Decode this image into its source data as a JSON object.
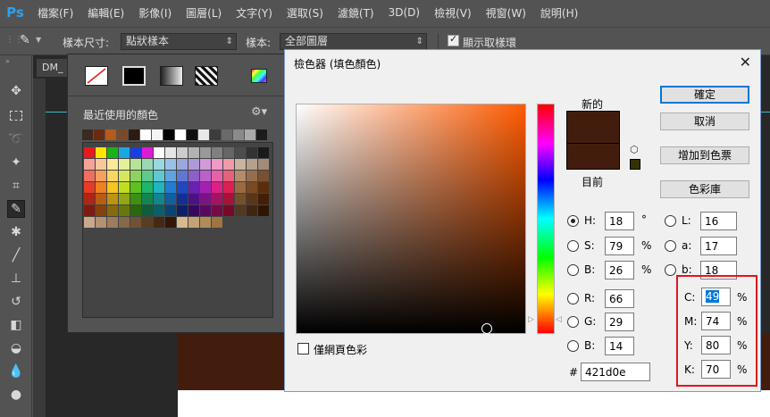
{
  "app": {
    "logo": "Ps"
  },
  "menu": [
    "檔案(F)",
    "編輯(E)",
    "影像(I)",
    "圖層(L)",
    "文字(Y)",
    "選取(S)",
    "濾鏡(T)",
    "3D(D)",
    "檢視(V)",
    "視窗(W)",
    "說明(H)"
  ],
  "options": {
    "sample_size_label": "樣本尺寸:",
    "sample_size_value": "點狀樣本",
    "sample_label": "樣本:",
    "sample_value": "全部圖層",
    "show_ring_label": "顯示取樣環"
  },
  "doc_tab": "DM_",
  "swatches": {
    "title": "最近使用的顏色",
    "recent": [
      "#3a2a20",
      "#6b2a10",
      "#b85a18",
      "#7a4a28",
      "#2e1a10",
      "#ffffff",
      "#f4f4f4",
      "#000000",
      "#ffffff",
      "#101010",
      "#e8e8e8",
      "#3c3c3c",
      "#6a6a6a",
      "#8a8a8a",
      "#aaaaaa",
      "#1c1c1c"
    ],
    "rows": [
      [
        "#e51b1b",
        "#ffe600",
        "#19b319",
        "#19a8e0",
        "#1a3fe0",
        "#e019d6",
        "#ffffff",
        "#e6e6e6",
        "#cccccc",
        "#b3b3b3",
        "#999999",
        "#808080",
        "#666666",
        "#4d4d4d",
        "#333333",
        "#1a1a1a"
      ],
      [
        "#f4a39a",
        "#f7c99a",
        "#fbe89a",
        "#e4f09a",
        "#b7e29a",
        "#9ad8b5",
        "#9ad8e0",
        "#9ac2e8",
        "#9aa8e0",
        "#ae9ad8",
        "#d19ad8",
        "#f09ac8",
        "#f09aa8",
        "#c8b4a0",
        "#b4a08c",
        "#a08c78"
      ],
      [
        "#ee6f5f",
        "#f4a160",
        "#f9d760",
        "#d5e760",
        "#8fd260",
        "#60c890",
        "#60c8d3",
        "#60a3de",
        "#6078d3",
        "#8c60c8",
        "#bd60c8",
        "#e860a8",
        "#e8607c",
        "#b48c6c",
        "#966e4e",
        "#785032"
      ],
      [
        "#e83b27",
        "#f07f1f",
        "#f6c51f",
        "#c1dd1f",
        "#5ec11f",
        "#1fb56b",
        "#1fb5c1",
        "#1f7ed3",
        "#1f48c1",
        "#6a1fb5",
        "#a61fb5",
        "#de1f85",
        "#de1f51",
        "#9c6a40",
        "#7a4a22",
        "#5a2e0a"
      ],
      [
        "#b02516",
        "#b85d12",
        "#bd9412",
        "#91a812",
        "#3e9012",
        "#128550",
        "#128591",
        "#125ea0",
        "#122f91",
        "#4c1285",
        "#7c1285",
        "#a61262",
        "#a6123a",
        "#74502d",
        "#5a3618",
        "#421f06"
      ],
      [
        "#7e1a0f",
        "#85420c",
        "#88690c",
        "#68790c",
        "#2b670c",
        "#0c5f38",
        "#0c5f68",
        "#0c4373",
        "#0c2068",
        "#36095f",
        "#59095f",
        "#760946",
        "#760929",
        "#533820",
        "#402612",
        "#2e1503"
      ],
      [
        "#c9a98a",
        "#b39374",
        "#9c7d5f",
        "#86684b",
        "#6f5237",
        "#5a3d25",
        "#452915",
        "#321708",
        "#d7b98f",
        "#c5a275",
        "#b28b5b",
        "#9f7442"
      ]
    ]
  },
  "picker": {
    "title": "檢色器 (填色顏色)",
    "new_label": "新的",
    "current_label": "目前",
    "new_color": "#421d0e",
    "current_color": "#421d0e",
    "web_only_label": "僅網頁色彩",
    "buttons": {
      "ok": "確定",
      "cancel": "取消",
      "add_swatch": "增加到色票",
      "libraries": "色彩庫"
    },
    "hsb": [
      {
        "label": "H:",
        "value": "18",
        "unit": "°"
      },
      {
        "label": "S:",
        "value": "79",
        "unit": "%"
      },
      {
        "label": "B:",
        "value": "26",
        "unit": "%"
      }
    ],
    "lab": [
      {
        "label": "L:",
        "value": "16"
      },
      {
        "label": "a:",
        "value": "17"
      },
      {
        "label": "b:",
        "value": "18"
      }
    ],
    "rgb": [
      {
        "label": "R:",
        "value": "66"
      },
      {
        "label": "G:",
        "value": "29"
      },
      {
        "label": "B:",
        "value": "14"
      }
    ],
    "cmyk": [
      {
        "label": "C:",
        "value": "49",
        "unit": "%"
      },
      {
        "label": "M:",
        "value": "74",
        "unit": "%"
      },
      {
        "label": "Y:",
        "value": "80",
        "unit": "%"
      },
      {
        "label": "K:",
        "value": "70",
        "unit": "%"
      }
    ],
    "hex_label": "#",
    "hex_value": "421d0e"
  }
}
